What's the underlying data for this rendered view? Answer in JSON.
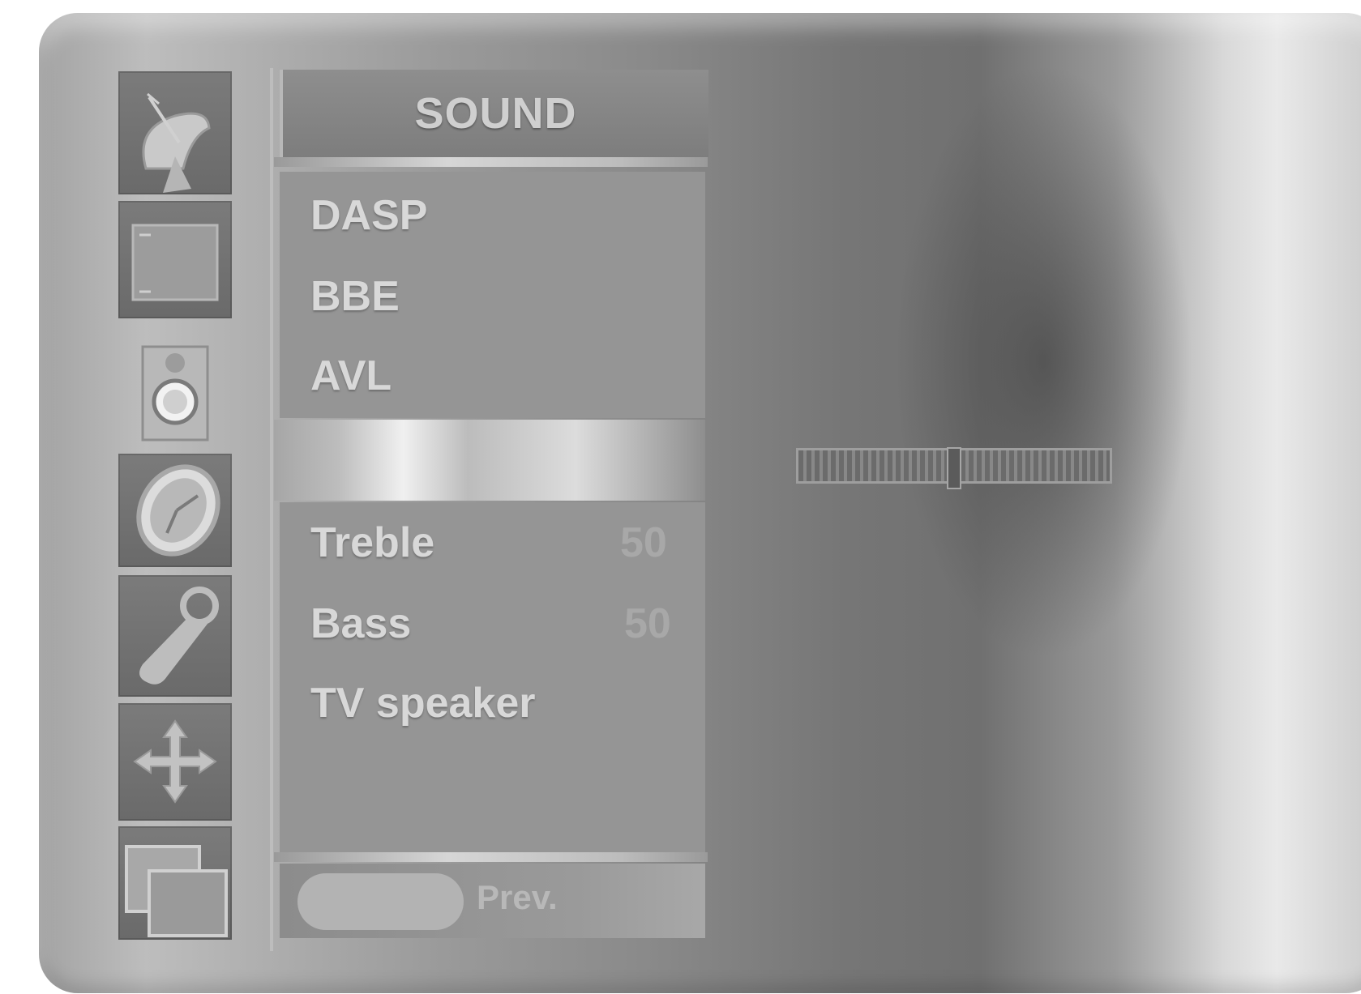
{
  "menu": {
    "title": "SOUND",
    "group1": [
      {
        "label": "DASP"
      },
      {
        "label": "BBE"
      },
      {
        "label": "AVL"
      }
    ],
    "group2": [
      {
        "label": "Treble",
        "value": "50"
      },
      {
        "label": "Bass",
        "value": "50"
      },
      {
        "label": "TV speaker",
        "value": ""
      }
    ],
    "footer": {
      "prev_label": "Prev."
    }
  },
  "sidebar": {
    "icons": [
      {
        "name": "satellite-dish-icon",
        "selected": false
      },
      {
        "name": "picture-screen-icon",
        "selected": false
      },
      {
        "name": "speaker-icon",
        "selected": true
      },
      {
        "name": "clock-icon",
        "selected": false
      },
      {
        "name": "wrench-icon",
        "selected": false
      },
      {
        "name": "move-arrows-icon",
        "selected": false
      },
      {
        "name": "input-windows-icon",
        "selected": false
      }
    ]
  },
  "slider": {
    "value": 50,
    "min": 0,
    "max": 100
  }
}
